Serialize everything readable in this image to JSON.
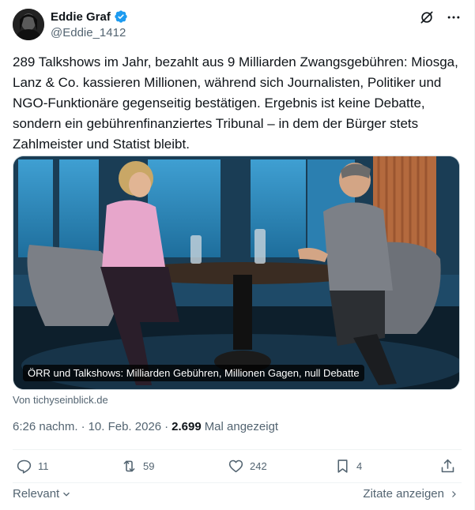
{
  "author": {
    "display_name": "Eddie Graf",
    "handle": "@Eddie_1412",
    "verified": true,
    "avatar_icon": "avatar-photo"
  },
  "tweet": {
    "text": "289 Talkshows im Jahr, bezahlt aus 9 Milliarden Zwangsgebühren: Miosga, Lanz & Co. kassieren Millionen, während sich Journalisten, Politiker und NGO-Funktionäre gegenseitig bestätigen. Ergebnis ist keine Debatte, sondern ein gebührenfinanziertes Tribunal – in dem der Bürger stets Zahlmeister und Statist bleibt."
  },
  "media": {
    "caption": "ÖRR und Talkshows: Milliarden Gebühren, Millionen Gagen, null Debatte",
    "source": "Von tichyseinblick.de"
  },
  "meta": {
    "time": "6:26 nachm.",
    "dot1": "·",
    "date": "10. Feb. 2026",
    "dot2": "·",
    "views_count": "2.699",
    "views_label": "Mal angezeigt"
  },
  "actions": {
    "replies": "11",
    "reposts": "59",
    "likes": "242",
    "bookmarks": "4"
  },
  "footer": {
    "sort_label": "Relevant",
    "quotes_label": "Zitate anzeigen"
  },
  "colors": {
    "text": "#0f1419",
    "muted": "#536471",
    "verified_blue": "#1d9bf0",
    "divider": "#eff3f4"
  }
}
